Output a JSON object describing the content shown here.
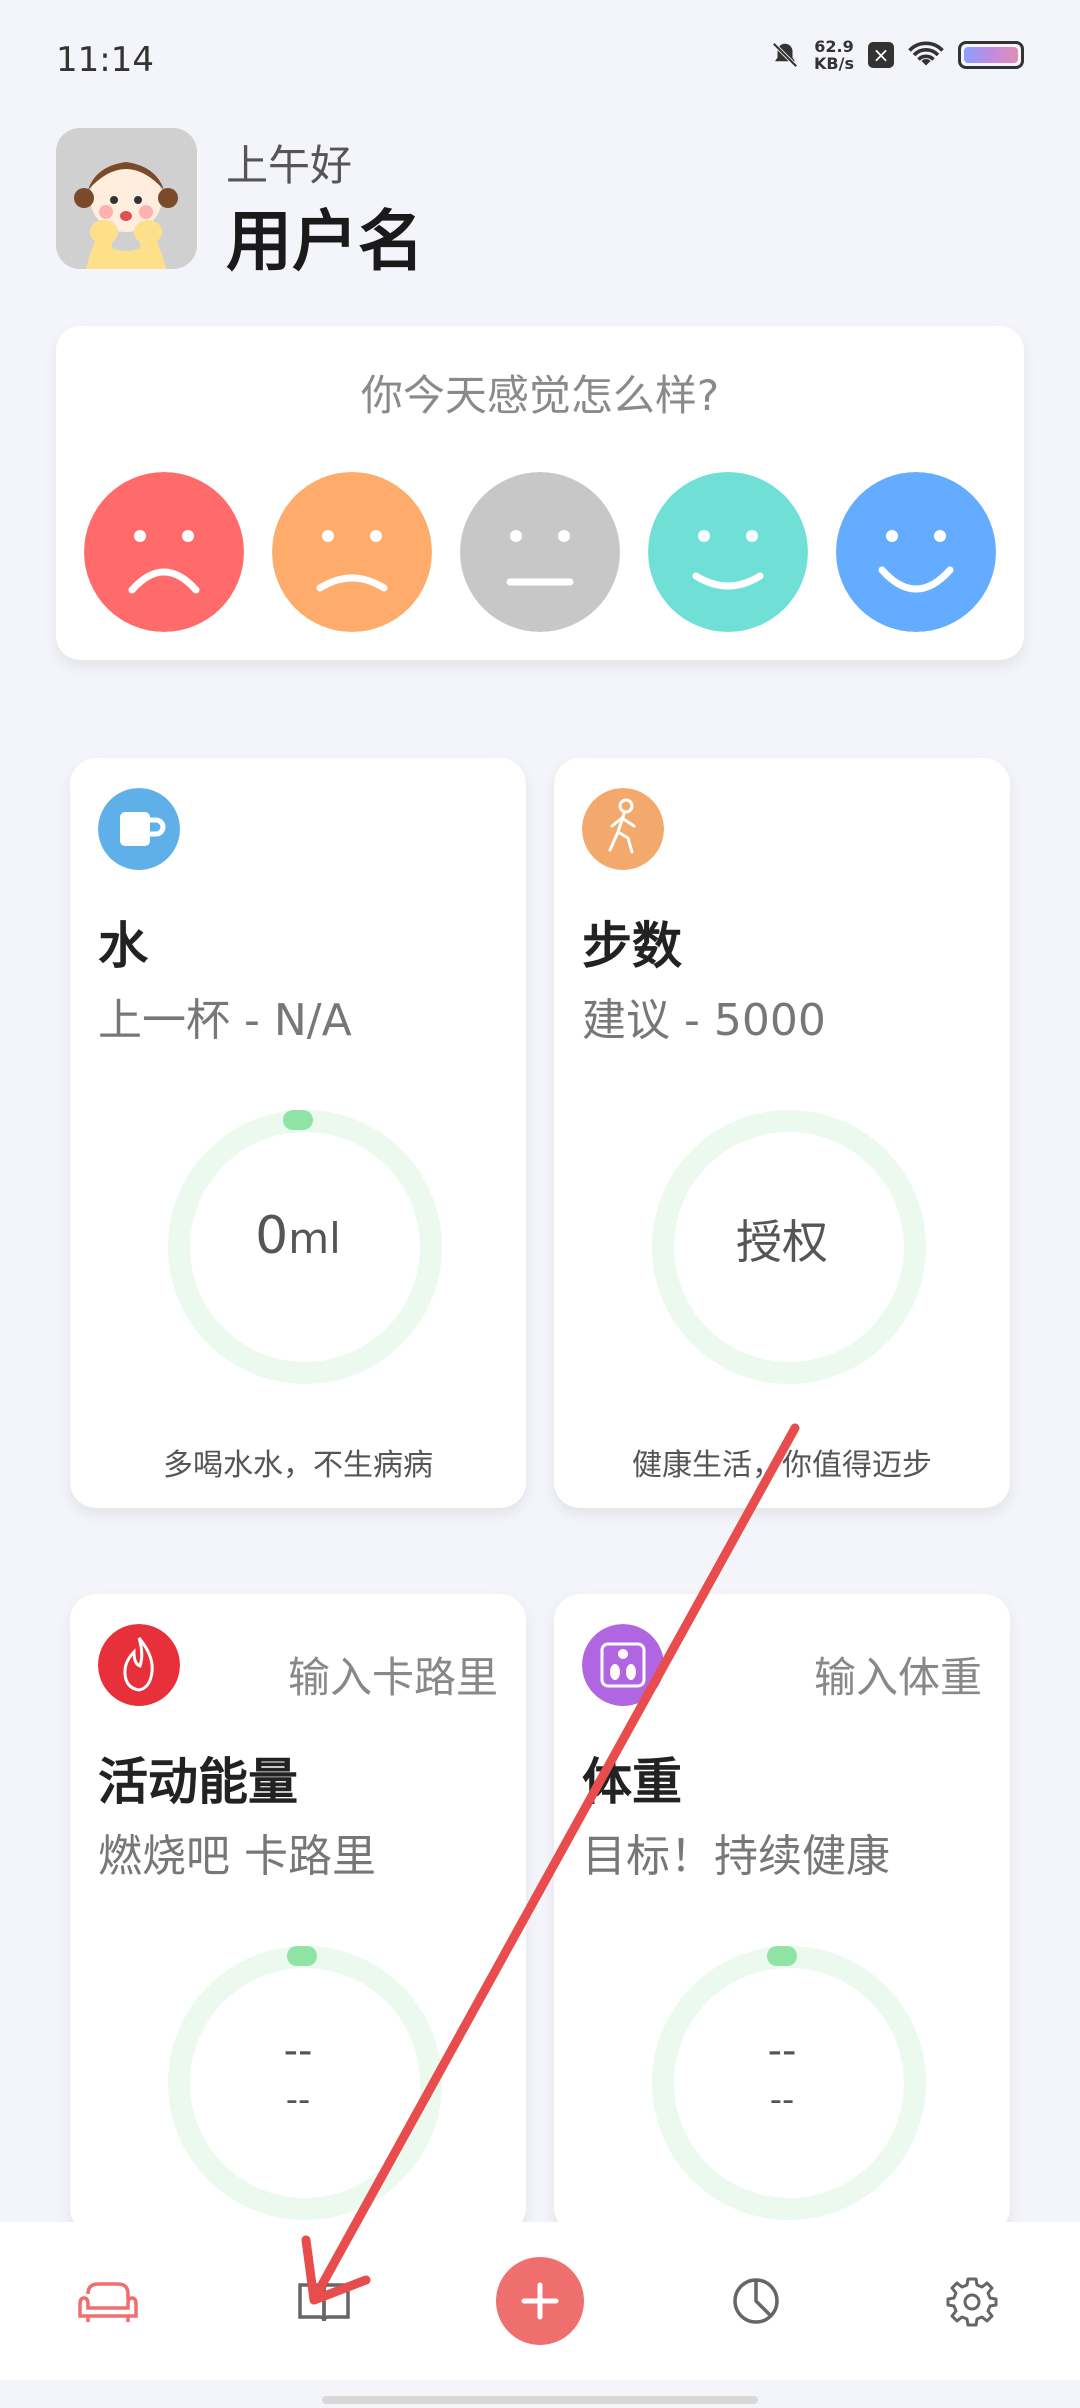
{
  "status_bar": {
    "time": "11:14",
    "net_speed_value": "62.9",
    "net_speed_unit": "KB/s",
    "icons": [
      "mute-bell-icon",
      "close-box-icon",
      "wifi-icon",
      "battery-icon"
    ]
  },
  "header": {
    "greeting": "上午好",
    "username": "用户名"
  },
  "mood": {
    "title": "你今天感觉怎么样?",
    "faces": [
      {
        "name": "very-sad",
        "color": "#ff6b6b"
      },
      {
        "name": "sad",
        "color": "#ffab6b"
      },
      {
        "name": "neutral",
        "color": "#c7c7c7"
      },
      {
        "name": "happy",
        "color": "#6fe0d6"
      },
      {
        "name": "very-happy",
        "color": "#63acff"
      }
    ]
  },
  "cards": {
    "water": {
      "title": "水",
      "subtitle": "上一杯 - N/A",
      "value": "0",
      "unit": "ml",
      "footer": "多喝水水，不生病病",
      "icon": "cup-icon",
      "color": "#5fb0e8"
    },
    "steps": {
      "title": "步数",
      "subtitle": "建议 - 5000",
      "value": "授权",
      "footer": "健康生活，你值得迈步",
      "icon": "walking-icon",
      "color": "#f4a96c"
    },
    "energy": {
      "title": "活动能量",
      "subtitle": "燃烧吧 卡路里",
      "action": "输入卡路里",
      "value_top": "--",
      "value_bottom": "--",
      "icon": "flame-icon",
      "color": "#e7303a"
    },
    "weight": {
      "title": "体重",
      "subtitle": "目标！持续健康",
      "action": "输入体重",
      "value_top": "--",
      "value_bottom": "--",
      "icon": "scale-icon",
      "color": "#b066e0"
    }
  },
  "bottom_nav": {
    "items": [
      "sofa-icon",
      "book-icon",
      "add-icon",
      "pie-chart-icon",
      "gear-icon"
    ],
    "accent": "#ef6f6f"
  }
}
